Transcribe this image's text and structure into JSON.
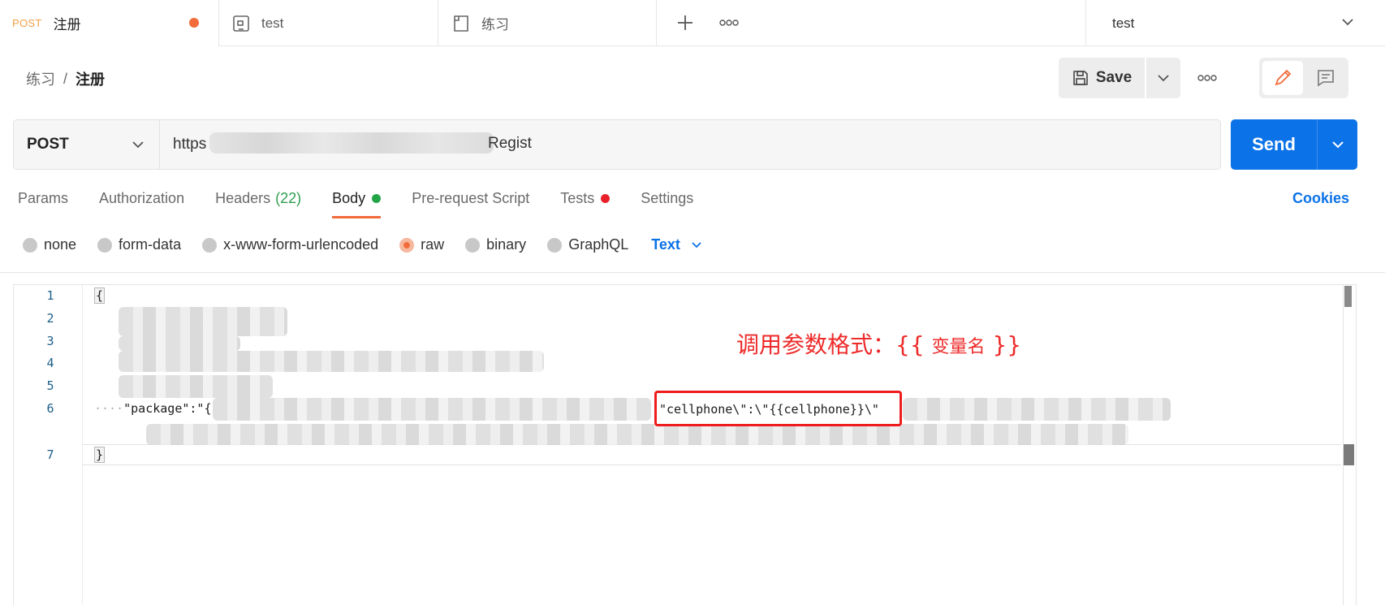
{
  "tabs": [
    {
      "method": "POST",
      "title": "注册",
      "unsaved": true
    },
    {
      "title": "test"
    },
    {
      "title": "练习"
    }
  ],
  "environment": {
    "selected": "test"
  },
  "breadcrumb": {
    "parent": "练习",
    "separator": "/",
    "current": "注册"
  },
  "toolbar": {
    "save_label": "Save"
  },
  "request": {
    "method": "POST",
    "url_prefix": "https",
    "url_suffix": "Regist",
    "send_label": "Send"
  },
  "request_tabs": [
    {
      "label": "Params"
    },
    {
      "label": "Authorization"
    },
    {
      "label": "Headers",
      "count": "(22)"
    },
    {
      "label": "Body",
      "dot_color": "#22a447",
      "active": true
    },
    {
      "label": "Pre-request Script"
    },
    {
      "label": "Tests",
      "dot_color": "#e8202a"
    },
    {
      "label": "Settings"
    }
  ],
  "cookies_label": "Cookies",
  "body_types": [
    {
      "label": "none",
      "selected": false
    },
    {
      "label": "form-data",
      "selected": false
    },
    {
      "label": "x-www-form-urlencoded",
      "selected": false
    },
    {
      "label": "raw",
      "selected": true
    },
    {
      "label": "binary",
      "selected": false
    },
    {
      "label": "GraphQL",
      "selected": false
    }
  ],
  "format": "Text",
  "editor": {
    "line_numbers": [
      "1",
      "2",
      "3",
      "4",
      "5",
      "6",
      "7"
    ],
    "line1": "{",
    "line6_indent": "····",
    "line6_start": "\"package\":\"{",
    "highlight": "\"cellphone\\\":\\\"{{cellphone}}\\\"",
    "line7": "}"
  },
  "annotation": {
    "main": "调用参数格式：{{ ",
    "var": "变量名",
    "close": " }}"
  },
  "colors": {
    "accent": "#f26b3a",
    "primary": "#0b72e7",
    "annotation": "#ee2a2a"
  }
}
